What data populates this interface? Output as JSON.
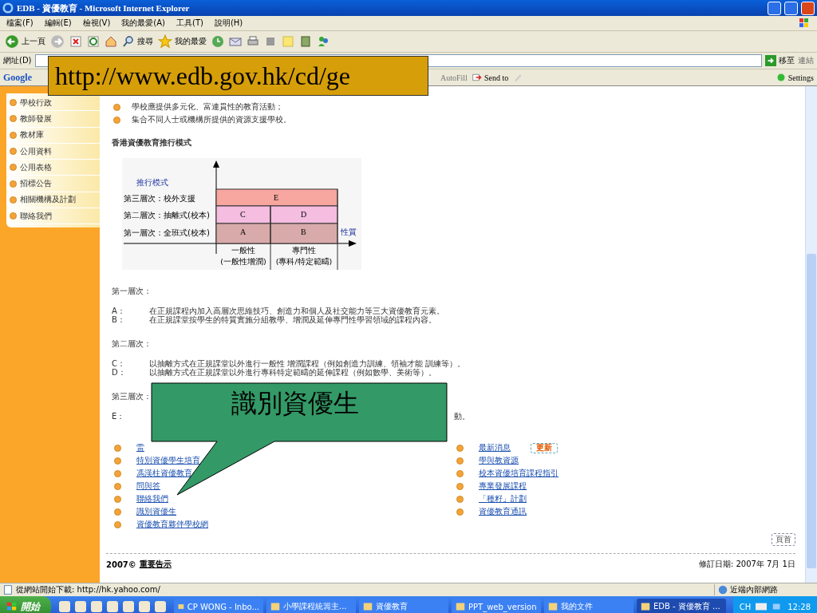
{
  "window": {
    "title": "EDB - 資優教育 - Microsoft Internet Explorer"
  },
  "menu": [
    "檔案(F)",
    "編輯(E)",
    "檢視(V)",
    "我的最愛(A)",
    "工具(T)",
    "說明(H)"
  ],
  "toolbar": {
    "back": "上一頁",
    "search": "搜尋",
    "favorites": "我的最愛"
  },
  "address_bar": {
    "label": "網址(D)",
    "go": "移至",
    "links": "連結"
  },
  "google_bar": {
    "logo": "Google",
    "autofill": "AutoFill",
    "send_to": "Send to",
    "settings": "Settings"
  },
  "url_callout": "http://www.edb.gov.hk/cd/ge",
  "sidebar": {
    "items": [
      "學校行政",
      "教師發展",
      "教材庫",
      "公用資料",
      "公用表格",
      "招標公告",
      "相關機構及計劃",
      "聯絡我們"
    ]
  },
  "content": {
    "bullets": [
      "學校應提供多元化、富連貫性的教育活動；",
      "集合不同人士或機構所提供的資源支援學校。"
    ],
    "heading": "香港資優教育推行模式",
    "diagram": {
      "mode_label": "推行模式",
      "axis_label": "性質",
      "levels": [
        {
          "label": "第三層次：校外支援",
          "blocks": [
            {
              "letter": "E",
              "color": "#f7a6a0"
            }
          ]
        },
        {
          "label": "第二層次：抽離式(校本)",
          "blocks": [
            {
              "letter": "C",
              "color": "#f5bde0"
            },
            {
              "letter": "D",
              "color": "#f5bde0"
            }
          ]
        },
        {
          "label": "第一層次：全班式(校本)",
          "blocks": [
            {
              "letter": "A",
              "color": "#d9aaaa"
            },
            {
              "letter": "B",
              "color": "#d9aaaa"
            }
          ]
        }
      ],
      "columns": [
        {
          "label": "一般性",
          "note": "(一般性增潤)"
        },
        {
          "label": "專門性",
          "note": "(專科/特定範疇)"
        }
      ]
    },
    "tiers": [
      {
        "title": "第一層次：",
        "items": [
          {
            "letter": "A：",
            "text": "在正規課程內加入高層次思維技巧、創造力和個人及社交能力等三大資優教育元素。"
          },
          {
            "letter": "B：",
            "text": "在正規課堂按學生的特質實施分組教學、增潤及延伸專門性學習領域的課程內容。"
          }
        ]
      },
      {
        "title": "第二層次：",
        "items": [
          {
            "letter": "C：",
            "text": "以抽離方式在正規課堂以外進行一般性 增潤課程（例如創造力訓練、領袖才能 訓練等）。"
          },
          {
            "letter": "D：",
            "text": "以抽離方式在正規課堂以外進行專科特定範疇的延伸課程（例如數學、美術等）。"
          }
        ]
      },
      {
        "title": "第三層次：",
        "items": [
          {
            "letter": "E：",
            "text": "動。"
          }
        ]
      }
    ],
    "links_left": [
      "雷",
      "特別資優學生培育",
      "馮漢柱資優教育",
      "問與答",
      "聯絡我們",
      "識別資優生",
      "資優教育夥伴學校網"
    ],
    "links_right": [
      {
        "label": "最新消息",
        "badge": "更新"
      },
      {
        "label": "學與教資源"
      },
      {
        "label": "校本資優培育課程指引"
      },
      {
        "label": "專業發展課程"
      },
      {
        "label": "「種籽」計劃"
      },
      {
        "label": "資優教育通訊"
      }
    ],
    "top_button": "頁首",
    "footer": {
      "copyright": "2007©",
      "notice": "重要告示",
      "revised": "修訂日期: 2007年 7月 1日"
    }
  },
  "callout": "識別資優生",
  "status_bar": {
    "text": "從網站開始下載: http://hk.yahoo.com/",
    "zone": "近端內部網路"
  },
  "taskbar": {
    "start": "開始",
    "tasks": [
      {
        "label": "CP WONG - Inbo...",
        "selected": false
      },
      {
        "label": "小學課程統籌主...",
        "selected": false
      },
      {
        "label": "資優教育",
        "selected": false
      },
      {
        "label": "PPT_web_version",
        "selected": false
      },
      {
        "label": "我的文件",
        "selected": false
      },
      {
        "label": "EDB - 資優教育 ...",
        "selected": true
      }
    ],
    "language": "CH",
    "clock": "12:28"
  }
}
